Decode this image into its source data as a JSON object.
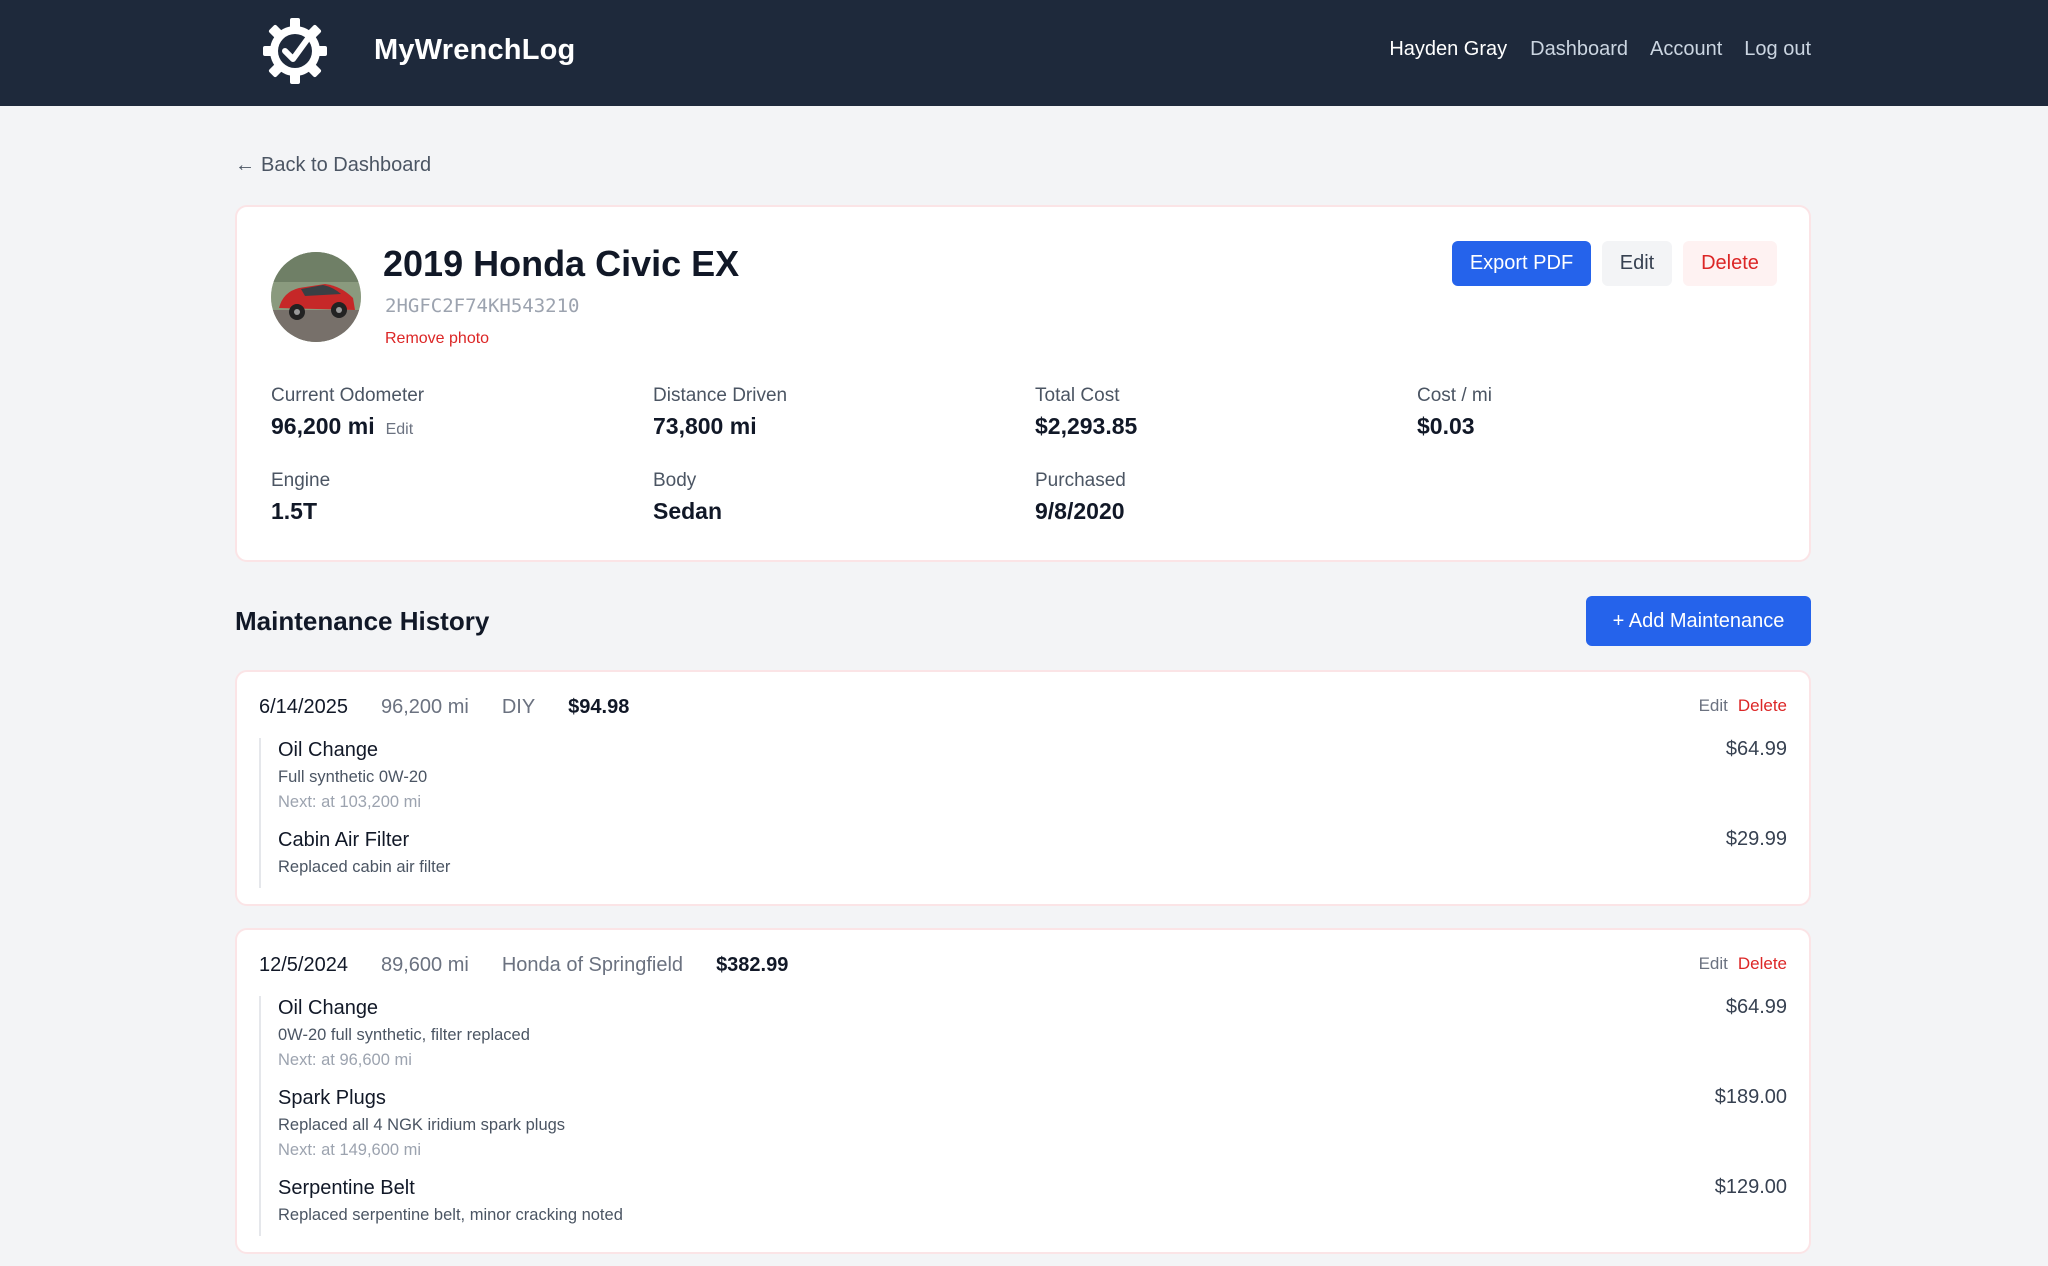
{
  "header": {
    "brand": "MyWrenchLog",
    "user": "Hayden Gray",
    "nav": [
      "Dashboard",
      "Account",
      "Log out"
    ]
  },
  "back_link": "Back to Dashboard",
  "vehicle": {
    "title": "2019 Honda Civic EX",
    "vin": "2HGFC2F74KH543210",
    "remove_photo": "Remove photo",
    "actions": {
      "export": "Export PDF",
      "edit": "Edit",
      "delete": "Delete"
    },
    "stats": {
      "odometer": {
        "label": "Current Odometer",
        "value": "96,200 mi",
        "edit": "Edit"
      },
      "distance": {
        "label": "Distance Driven",
        "value": "73,800 mi"
      },
      "total_cost": {
        "label": "Total Cost",
        "value": "$2,293.85"
      },
      "cost_per_mi": {
        "label": "Cost / mi",
        "value": "$0.03"
      },
      "engine": {
        "label": "Engine",
        "value": "1.5T"
      },
      "body": {
        "label": "Body",
        "value": "Sedan"
      },
      "purchased": {
        "label": "Purchased",
        "value": "9/8/2020"
      }
    }
  },
  "maintenance": {
    "title": "Maintenance History",
    "add_button": "+ Add Maintenance",
    "records": [
      {
        "date": "6/14/2025",
        "miles": "96,200 mi",
        "shop": "DIY",
        "total": "$94.98",
        "edit": "Edit",
        "delete": "Delete",
        "items": [
          {
            "name": "Oil Change",
            "desc": "Full synthetic 0W-20",
            "next": "Next: at 103,200 mi",
            "price": "$64.99"
          },
          {
            "name": "Cabin Air Filter",
            "desc": "Replaced cabin air filter",
            "price": "$29.99"
          }
        ]
      },
      {
        "date": "12/5/2024",
        "miles": "89,600 mi",
        "shop": "Honda of Springfield",
        "total": "$382.99",
        "edit": "Edit",
        "delete": "Delete",
        "items": [
          {
            "name": "Oil Change",
            "desc": "0W-20 full synthetic, filter replaced",
            "next": "Next: at 96,600 mi",
            "price": "$64.99"
          },
          {
            "name": "Spark Plugs",
            "desc": "Replaced all 4 NGK iridium spark plugs",
            "next": "Next: at 149,600 mi",
            "price": "$189.00"
          },
          {
            "name": "Serpentine Belt",
            "desc": "Replaced serpentine belt, minor cracking noted",
            "price": "$129.00"
          }
        ]
      }
    ]
  }
}
